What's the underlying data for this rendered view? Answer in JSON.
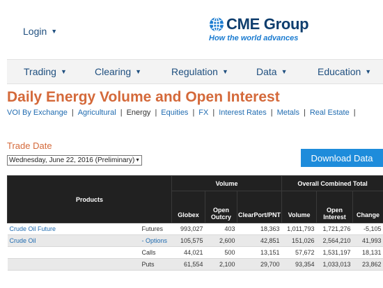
{
  "header": {
    "login_label": "Login",
    "logo_text": "CME Group",
    "tagline": "How the world advances"
  },
  "nav": {
    "items": [
      {
        "label": "Trading"
      },
      {
        "label": "Clearing"
      },
      {
        "label": "Regulation"
      },
      {
        "label": "Data"
      },
      {
        "label": "Education"
      }
    ]
  },
  "page": {
    "title": "Daily Energy Volume and Open Interest"
  },
  "subnav": {
    "items": [
      "VOI By Exchange",
      "Agricultural",
      "Energy",
      "Equities",
      "FX",
      "Interest Rates",
      "Metals",
      "Real Estate"
    ],
    "active": "Energy"
  },
  "trade_date": {
    "label": "Trade Date",
    "selected": "Wednesday, June 22, 2016 (Preliminary)"
  },
  "download_label": "Download Data",
  "table": {
    "products_header": "Products",
    "volume_header": "Volume",
    "total_header": "Overall Combined Total",
    "columns": [
      "Globex",
      "Open Outcry",
      "ClearPort/PNT",
      "Volume",
      "Open Interest",
      "Change"
    ],
    "rows": [
      {
        "product": "Crude Oil Future",
        "type": "Futures",
        "globex": "993,027",
        "outcry": "403",
        "clearport": "18,363",
        "volume": "1,011,793",
        "oi": "1,721,276",
        "change": "-5,105"
      },
      {
        "product": "Crude Oil",
        "type": "- Options",
        "globex": "105,575",
        "outcry": "2,600",
        "clearport": "42,851",
        "volume": "151,026",
        "oi": "2,564,210",
        "change": "41,993"
      },
      {
        "product": "",
        "type": "Calls",
        "globex": "44,021",
        "outcry": "500",
        "clearport": "13,151",
        "volume": "57,672",
        "oi": "1,531,197",
        "change": "18,131"
      },
      {
        "product": "",
        "type": "Puts",
        "globex": "61,554",
        "outcry": "2,100",
        "clearport": "29,700",
        "volume": "93,354",
        "oi": "1,033,013",
        "change": "23,862"
      }
    ]
  },
  "colors": {
    "brand_blue": "#0f3e6e",
    "accent_orange": "#d4693a",
    "link_blue": "#1f6bb0",
    "button_blue": "#1e8cdb"
  }
}
